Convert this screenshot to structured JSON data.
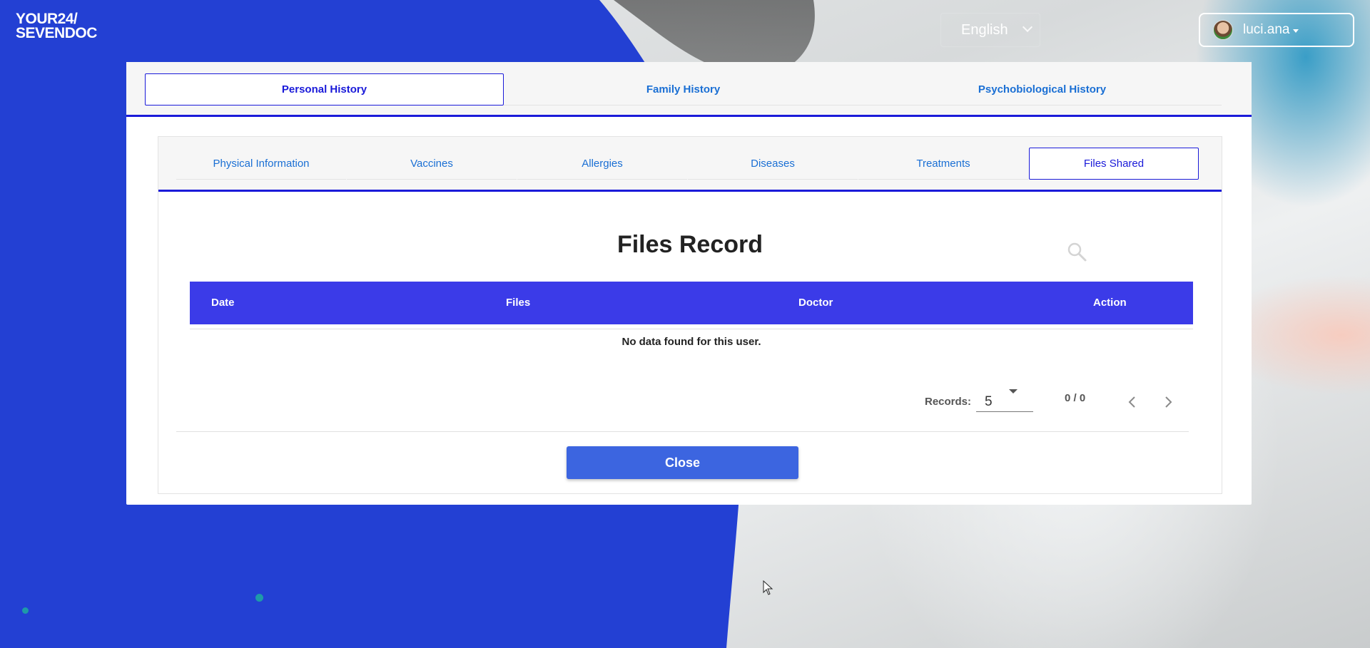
{
  "logo": {
    "line1": "YOUR24/",
    "line2": "SEVENDOC"
  },
  "header": {
    "language": "English",
    "username": "luci.ana"
  },
  "top_tabs": [
    {
      "label": "Personal History",
      "active": true
    },
    {
      "label": "Family History",
      "active": false
    },
    {
      "label": "Psychobiological History",
      "active": false
    }
  ],
  "sub_tabs": [
    {
      "label": "Physical Information",
      "active": false
    },
    {
      "label": "Vaccines",
      "active": false
    },
    {
      "label": "Allergies",
      "active": false
    },
    {
      "label": "Diseases",
      "active": false
    },
    {
      "label": "Treatments",
      "active": false
    },
    {
      "label": "Files Shared",
      "active": true
    }
  ],
  "content": {
    "title": "Files Record",
    "columns": [
      "Date",
      "Files",
      "Doctor",
      "Action"
    ],
    "empty_message": "No data found for this user."
  },
  "pagination": {
    "records_label": "Records:",
    "records_per_page": "5",
    "count": "0 / 0"
  },
  "close_label": "Close",
  "colors": {
    "background_blue": "#2340d3",
    "tab_accent": "#1a1ad9",
    "table_header": "#3b3be8",
    "close_button": "#3c65e0"
  }
}
